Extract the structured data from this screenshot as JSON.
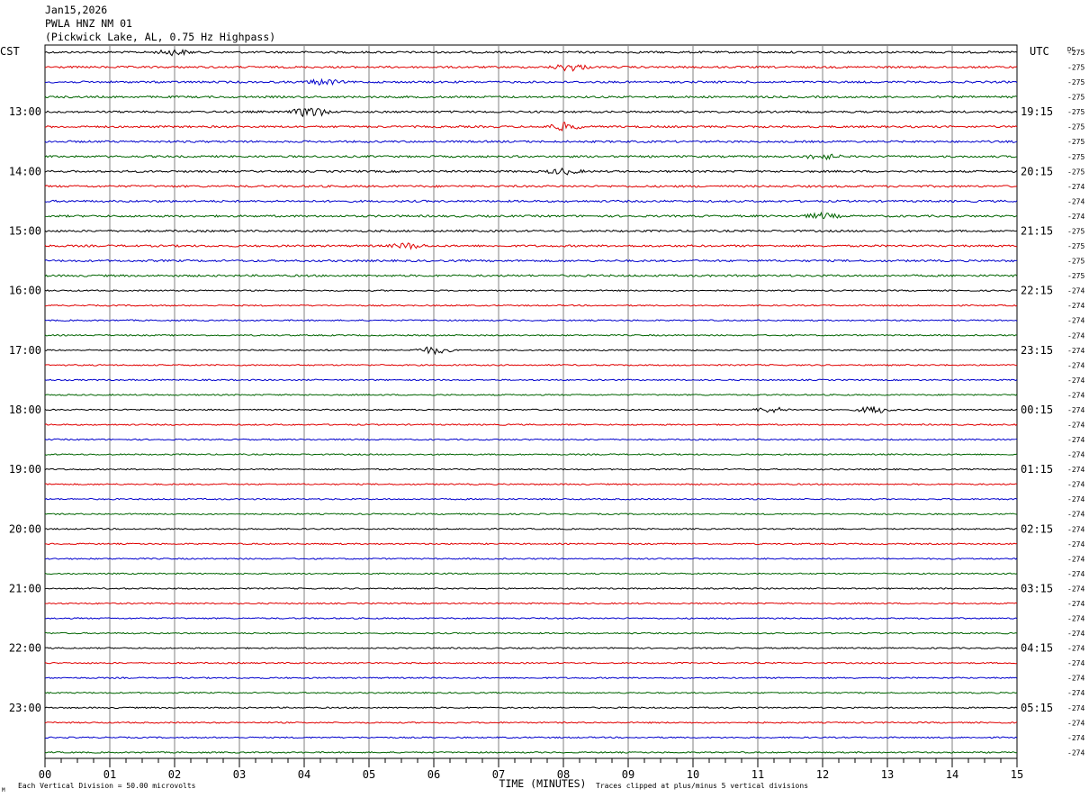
{
  "header": {
    "date": "Jan15,2026",
    "station": "PWLA HNZ NM 01",
    "location": "(Pickwick Lake, AL, 0.75 Hz Highpass)"
  },
  "left_timezone": "CST",
  "right_timezone": "UTC",
  "dc_label": "DC",
  "footer": {
    "scale": "Each Vertical Division =   50.00 microvolts",
    "xlabel": "TIME (MINUTES)",
    "clip": "Traces clipped at plus/minus 5 vertical divisions",
    "corner_mark": "M"
  },
  "colors": {
    "trace_cycle": [
      "#000000",
      "#e00000",
      "#0000cc",
      "#006400"
    ],
    "grid": "#808080"
  },
  "chart_data": {
    "type": "line",
    "title": "PWLA HNZ NM 01",
    "xlabel": "TIME (MINUTES)",
    "xlim": [
      0,
      15
    ],
    "x_ticks": [
      "00",
      "01",
      "02",
      "03",
      "04",
      "05",
      "06",
      "07",
      "08",
      "09",
      "10",
      "11",
      "12",
      "13",
      "14",
      "15"
    ],
    "left_hour_labels": [
      "13:00",
      "14:00",
      "15:00",
      "16:00",
      "17:00",
      "18:00",
      "19:00",
      "20:00",
      "21:00",
      "22:00",
      "23:00"
    ],
    "right_hour_labels": [
      "19:15",
      "20:15",
      "21:15",
      "22:15",
      "23:15",
      "00:15",
      "01:15",
      "02:15",
      "03:15",
      "04:15",
      "05:15"
    ],
    "dc_offsets": [
      "-275",
      "-275",
      "-275",
      "-275",
      "-275",
      "-275",
      "-275",
      "-275",
      "-275",
      "-274",
      "-274",
      "-274",
      "-275",
      "-275",
      "-275",
      "-275",
      "-274",
      "-274",
      "-274",
      "-274",
      "-274",
      "-274",
      "-274",
      "-274",
      "-274",
      "-274",
      "-274",
      "-274",
      "-274",
      "-274",
      "-274",
      "-274",
      "-274",
      "-274",
      "-274",
      "-274",
      "-274",
      "-274",
      "-274",
      "-274",
      "-274",
      "-274",
      "-274",
      "-274",
      "-274",
      "-274",
      "-274",
      "-274"
    ],
    "trace_count": 48,
    "trace_interval_minutes": 15,
    "events": [
      {
        "trace": 0,
        "minute": 2.0,
        "amp": 3
      },
      {
        "trace": 1,
        "minute": 8.1,
        "amp": 4
      },
      {
        "trace": 2,
        "minute": 4.3,
        "amp": 3
      },
      {
        "trace": 4,
        "minute": 4.1,
        "amp": 6
      },
      {
        "trace": 5,
        "minute": 8.0,
        "amp": 4
      },
      {
        "trace": 7,
        "minute": 12.0,
        "amp": 3
      },
      {
        "trace": 8,
        "minute": 8.0,
        "amp": 3
      },
      {
        "trace": 11,
        "minute": 12.0,
        "amp": 3
      },
      {
        "trace": 13,
        "minute": 5.6,
        "amp": 3
      },
      {
        "trace": 20,
        "minute": 6.0,
        "amp": 4
      },
      {
        "trace": 24,
        "minute": 11.2,
        "amp": 3
      },
      {
        "trace": 24,
        "minute": 12.8,
        "amp": 4
      }
    ]
  }
}
